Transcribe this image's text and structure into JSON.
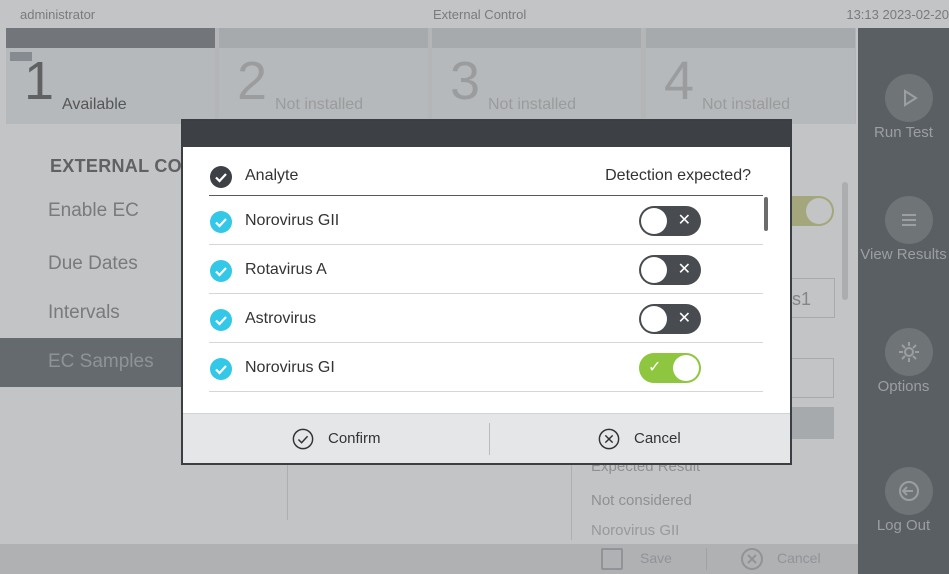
{
  "topbar": {
    "user": "administrator",
    "title": "External Control",
    "clock": "13:13 2023-02-20"
  },
  "modules": [
    {
      "number": "1",
      "state": "Available"
    },
    {
      "number": "2",
      "state": "Not installed"
    },
    {
      "number": "3",
      "state": "Not installed"
    },
    {
      "number": "4",
      "state": "Not installed"
    }
  ],
  "side_nav": {
    "run_test": "Run Test",
    "view_results": "View Results",
    "options": "Options",
    "log_out": "Log Out"
  },
  "left_menu": {
    "heading": "EXTERNAL CO",
    "items": [
      "Enable EC",
      "Due Dates",
      "Intervals",
      "EC Samples"
    ],
    "active_index": 3
  },
  "background": {
    "field_text": "s1",
    "expected_result_label": "Expected Result",
    "not_considered": "Not considered",
    "norovirus_cut": "Norovirus GII"
  },
  "footer": {
    "save": "Save",
    "cancel": "Cancel"
  },
  "dialog": {
    "column_analyte": "Analyte",
    "column_detection": "Detection expected?",
    "rows": [
      {
        "name": "Norovirus GII",
        "checked": true,
        "detection_expected": false,
        "mark": "✕"
      },
      {
        "name": "Rotavirus A",
        "checked": true,
        "detection_expected": false,
        "mark": "✕"
      },
      {
        "name": "Astrovirus",
        "checked": true,
        "detection_expected": false,
        "mark": "✕"
      },
      {
        "name": "Norovirus GI",
        "checked": true,
        "detection_expected": true,
        "mark": "✓"
      }
    ],
    "confirm": "Confirm",
    "cancel": "Cancel"
  },
  "colors": {
    "check_cyan": "#33c7e8",
    "check_dark": "#3d4044",
    "toggle_off": "#484c51",
    "toggle_on": "#8ec63f",
    "modal_header": "#3d4044"
  }
}
